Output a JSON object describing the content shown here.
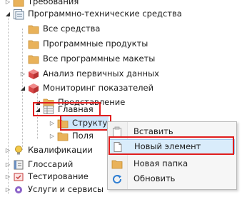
{
  "tree": {
    "items": [
      {
        "label": "Требования",
        "icon": "folder-icon",
        "expanded": false
      },
      {
        "label": "Программно-технические средства",
        "icon": "doc-folder-icon",
        "expanded": true
      },
      {
        "label": "Все средства",
        "icon": "folder-icon",
        "expanded": false
      },
      {
        "label": "Программные продукты",
        "icon": "folder-icon",
        "expanded": false
      },
      {
        "label": "Все программные макеты",
        "icon": "folder-icon",
        "expanded": false
      },
      {
        "label": "Анализ первичных данных",
        "icon": "cube-icon",
        "expanded": false
      },
      {
        "label": "Мониторинг показателей",
        "icon": "cube-icon",
        "expanded": true
      },
      {
        "label": "Представление",
        "icon": "folder-icon",
        "expanded": true
      },
      {
        "label": "Главная",
        "icon": "grid-icon",
        "expanded": true
      },
      {
        "label": "Структу",
        "icon": "folder-icon",
        "expanded": false
      },
      {
        "label": "Поля",
        "icon": "folder-icon",
        "expanded": false
      },
      {
        "label": "Квалификации",
        "icon": "bulb-icon",
        "expanded": false
      },
      {
        "label": "Глоссарий",
        "icon": "book-icon",
        "expanded": false
      },
      {
        "label": "Тестирование",
        "icon": "test-icon",
        "expanded": false
      },
      {
        "label": "Услуги и сервисы",
        "icon": "gear-icon",
        "expanded": false
      }
    ]
  },
  "context_menu": {
    "items": [
      {
        "label": "Вставить",
        "icon": "paste-icon"
      },
      {
        "label": "Новый элемент",
        "icon": "new-item-icon"
      },
      {
        "label": "Новая папка",
        "icon": "new-folder-icon"
      },
      {
        "label": "Обновить",
        "icon": "refresh-icon"
      }
    ]
  },
  "colors": {
    "highlight": "#e01d1d",
    "folder": "#e9b25a",
    "selection": "#cfe6fb"
  }
}
